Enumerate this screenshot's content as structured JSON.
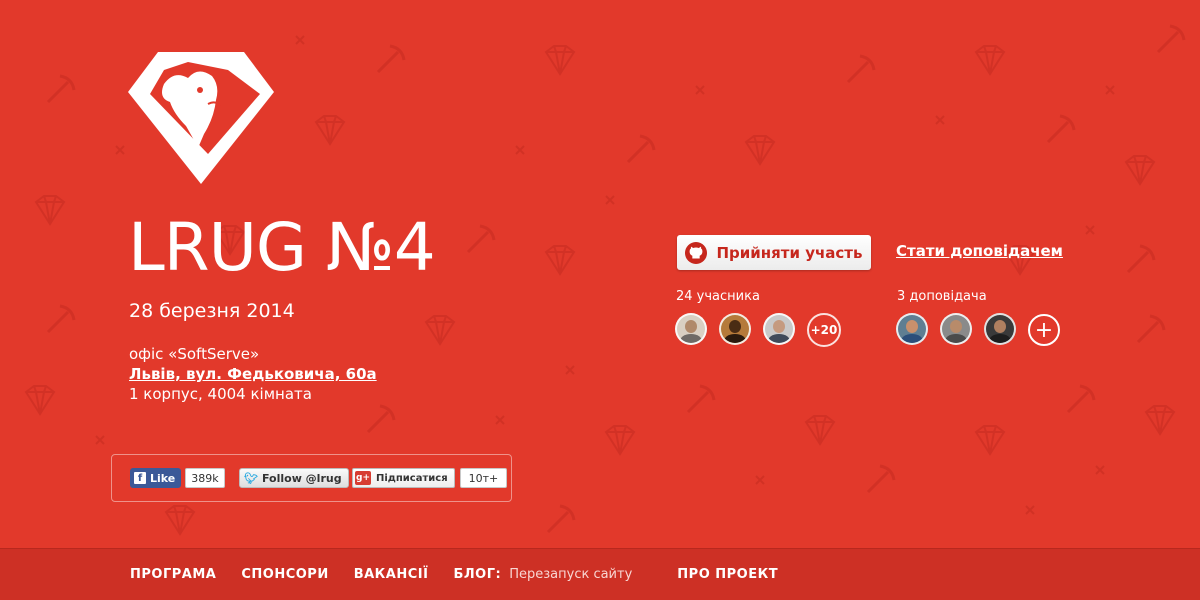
{
  "event": {
    "title": "LRUG №4",
    "date": "28 березня 2014",
    "office": "офіс «SoftServe»",
    "address": "Львів, вул. Федьковича, 60а",
    "room": "1 корпус, 4004 кімната"
  },
  "social": {
    "facebook_label": "Like",
    "facebook_count": "389k",
    "twitter_label": "Follow @lrug",
    "gplus_label": "Підписатися",
    "gplus_count": "10т+"
  },
  "actions": {
    "participate_label": "Прийняти участь",
    "speaker_label": "Стати доповідачем"
  },
  "attendees": {
    "count_label": "24 учасника",
    "more_label": "+20"
  },
  "speakers": {
    "count_label": "3 доповідача",
    "add_label": "+"
  },
  "nav": {
    "program": "ПРОГРАМА",
    "sponsors": "СПОНСОРИ",
    "vacancies": "ВАКАНСІЇ",
    "blog_label": "БЛОГ:",
    "blog_post": "Перезапуск сайту",
    "about": "ПРО ПРОЕКТ"
  },
  "colors": {
    "background": "#e2392b",
    "footer": "#cd3025",
    "accent": "#c6271d"
  },
  "icons": [
    "lion-diamond-logo",
    "github-icon",
    "facebook-icon",
    "twitter-icon",
    "google-plus-icon",
    "plus-icon"
  ]
}
